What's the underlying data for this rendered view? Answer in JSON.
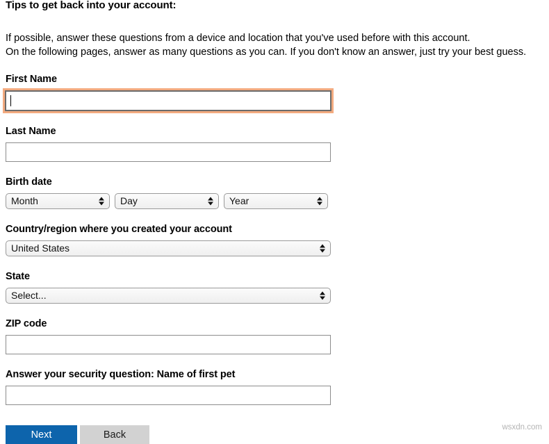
{
  "page": {
    "title": "Tips to get back into your account:",
    "intro_line_1": "If possible, answer these questions from a device and location that you've used before with this account.",
    "intro_line_2": "On the following pages, answer as many questions as you can. If you don't know an answer, just try your best guess."
  },
  "form": {
    "first_name": {
      "label": "First Name",
      "value": "",
      "placeholder": ""
    },
    "last_name": {
      "label": "Last Name",
      "value": "",
      "placeholder": ""
    },
    "birth_date": {
      "label": "Birth date",
      "month": "Month",
      "day": "Day",
      "year": "Year"
    },
    "country": {
      "label": "Country/region where you created your account",
      "value": "United States"
    },
    "state": {
      "label": "State",
      "value": "Select..."
    },
    "zip": {
      "label": "ZIP code",
      "value": "",
      "placeholder": ""
    },
    "security_question": {
      "label": "Answer your security question: Name of first pet",
      "value": "",
      "placeholder": ""
    }
  },
  "actions": {
    "next_label": "Next",
    "back_label": "Back"
  },
  "watermark": "wsxdn.com",
  "colors": {
    "primary_button": "#0d64ac",
    "secondary_button": "#d2d2d2",
    "focus_ring": "#f3ab80",
    "input_border": "#8c8c8c"
  }
}
